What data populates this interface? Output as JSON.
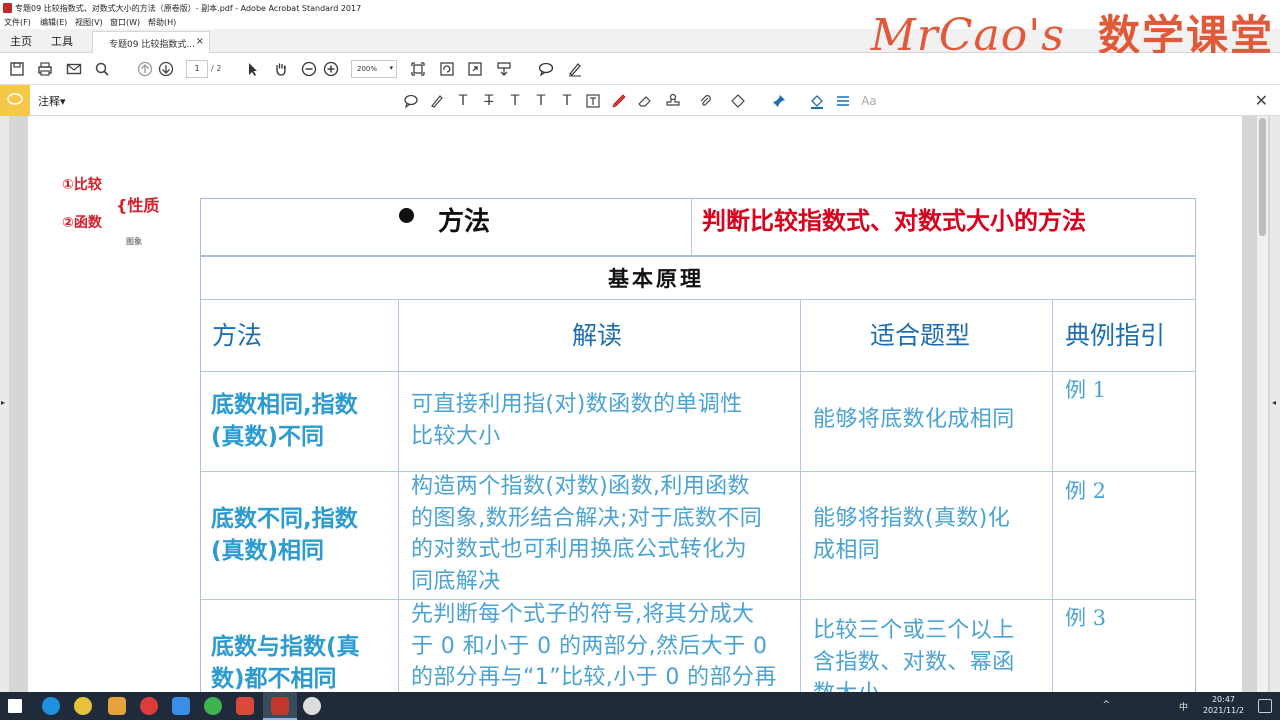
{
  "window": {
    "title": "专题09 比较指数式、对数式大小的方法（原卷版）- 副本.pdf - Adobe Acrobat Standard 2017",
    "menu": [
      "文件(F)",
      "编辑(E)",
      "视图(V)",
      "窗口(W)",
      "帮助(H)"
    ]
  },
  "watermark": {
    "en": "MrCao's",
    "cn": "数学课堂"
  },
  "tabs": {
    "home": "主页",
    "tools": "工具",
    "doc": "专题09 比较指数式...",
    "close": "×"
  },
  "toolbar": {
    "page_current": "1",
    "page_total": "/ 2",
    "zoom": "200%",
    "zoom_caret": "▾"
  },
  "commentbar": {
    "label": "注释▾",
    "close": "✕"
  },
  "handwriting": {
    "line1": "①比较",
    "line2": "②函数",
    "brace": "{性质",
    "note": "图象"
  },
  "document": {
    "header_method": "方法",
    "header_title": "判断比较指数式、对数式大小的方法",
    "section_title": "基本原理",
    "columns": [
      "方法",
      "解读",
      "适合题型",
      "典例指引"
    ],
    "rows": [
      {
        "method": [
          "底数相同,指数",
          "(真数)不同"
        ],
        "desc": [
          "可直接利用指(对)数函数的单调性",
          "比较大小"
        ],
        "type": [
          "能够将底数化成相同"
        ],
        "example": "例 1"
      },
      {
        "method": [
          "底数不同,指数",
          "(真数)相同"
        ],
        "desc": [
          "构造两个指数(对数)函数,利用函数",
          "的图象,数形结合解决;对于底数不同",
          "的对数式也可利用换底公式转化为",
          "同底解决"
        ],
        "type": [
          "能够将指数(真数)化",
          "成相同"
        ],
        "example": "例 2"
      },
      {
        "method": [
          "底数与指数(真",
          "数)都不相同"
        ],
        "desc": [
          "先判断每个式子的符号,将其分成大",
          "于 0 和小于 0 的两部分,然后大于 0",
          "的部分再与“1”比较,小于 0 的部分再"
        ],
        "type": [
          "比较三个或三个以上",
          "含指数、对数、幂函",
          "数大小"
        ],
        "example": "例 3"
      }
    ]
  },
  "taskbar": {
    "time": "20:47",
    "date": "2021/11/2",
    "ime": "中",
    "caret": "^"
  }
}
